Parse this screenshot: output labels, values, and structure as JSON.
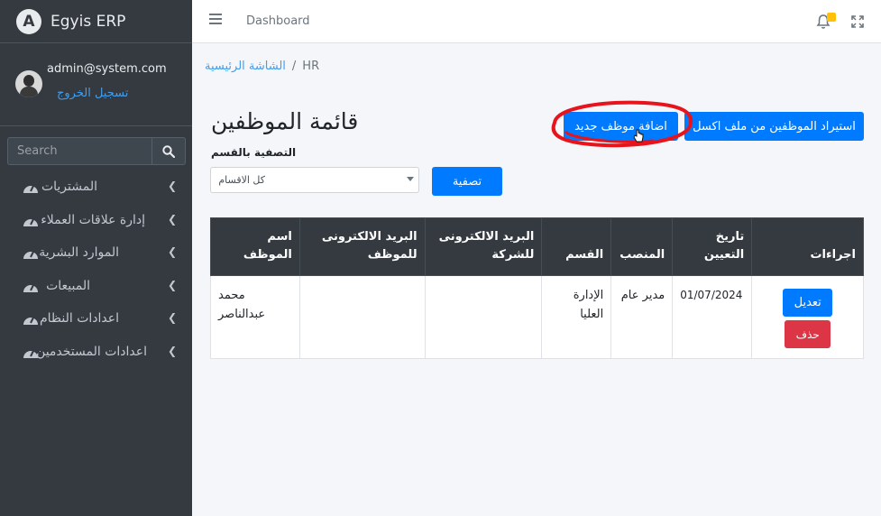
{
  "brand": {
    "logo_letter": "A",
    "name": "Egyis ERP"
  },
  "user": {
    "email": "admin@system.com",
    "logout": "تسجيل الخروج"
  },
  "search": {
    "placeholder": "Search"
  },
  "sidebar": {
    "items": [
      {
        "label": "المشتريات"
      },
      {
        "label": "إدارة علاقات العملاء"
      },
      {
        "label": "الموارد البشرية"
      },
      {
        "label": "المبيعات"
      },
      {
        "label": "اعدادات النظام"
      },
      {
        "label": "اعدادات المستخدمين"
      }
    ]
  },
  "header": {
    "dashboard_link": "Dashboard",
    "notification_badge": ""
  },
  "breadcrumb": {
    "home": "الشاشة الرئيسية",
    "separator": "/",
    "current": "HR"
  },
  "page": {
    "title": "قائمة الموظفين",
    "import_button": "استيراد الموظفين من ملف اكسل",
    "add_button": "اضافة موظف جديد",
    "filter_label": "التصفية بالقسم",
    "filter_select_value": "كل الاقسام",
    "filter_button": "تصفية"
  },
  "table": {
    "headers": {
      "name": "اسم الموظف",
      "personal_email": "البريد الالكترونى للموظف",
      "company_email": "البريد الالكترونى للشركة",
      "department": "القسم",
      "position": "المنصب",
      "hire_date": "تاريخ التعيين",
      "actions": "اجراءات"
    },
    "rows": [
      {
        "name": "محمد عبدالناصر",
        "personal_email": "",
        "company_email": "",
        "department": "الإدارة العليا",
        "position": "مدير عام",
        "hire_date": "01/07/2024",
        "edit_label": "تعديل",
        "delete_label": "حذف"
      }
    ]
  },
  "colors": {
    "sidebar_bg": "#343a40",
    "primary": "#007bff",
    "danger": "#dc3545",
    "link": "#3f9ef1",
    "annotation": "#e8141c"
  }
}
